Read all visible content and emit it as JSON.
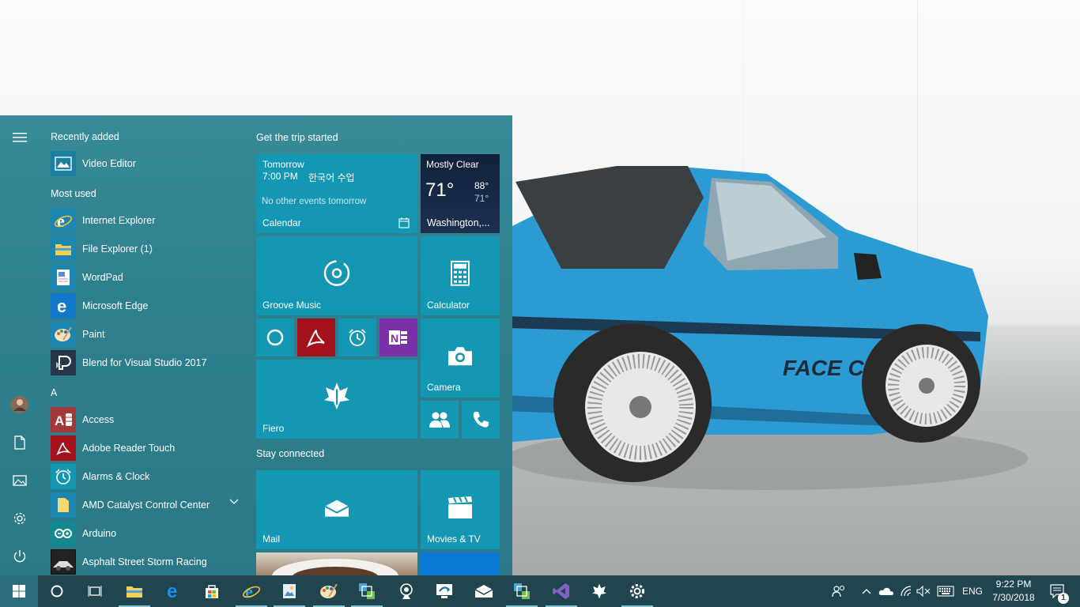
{
  "start_menu": {
    "sections": {
      "recently_added": "Recently added",
      "most_used": "Most used",
      "letter_a": "A"
    },
    "recently_added": [
      {
        "label": "Video Editor",
        "icon": "video-editor-icon"
      }
    ],
    "most_used": [
      {
        "label": "Internet Explorer",
        "icon": "internet-explorer-icon"
      },
      {
        "label": "File Explorer (1)",
        "icon": "file-explorer-icon"
      },
      {
        "label": "WordPad",
        "icon": "wordpad-icon"
      },
      {
        "label": "Microsoft Edge",
        "icon": "edge-icon"
      },
      {
        "label": "Paint",
        "icon": "paint-icon"
      },
      {
        "label": "Blend for Visual Studio 2017",
        "icon": "blend-icon"
      }
    ],
    "a_apps": [
      {
        "label": "Access",
        "icon": "access-icon"
      },
      {
        "label": "Adobe Reader Touch",
        "icon": "adobe-reader-icon"
      },
      {
        "label": "Alarms & Clock",
        "icon": "alarm-clock-icon"
      },
      {
        "label": "AMD Catalyst Control Center",
        "icon": "folder-icon",
        "expandable": true
      },
      {
        "label": "Arduino",
        "icon": "arduino-icon"
      },
      {
        "label": "Asphalt Street Storm Racing",
        "icon": "asphalt-icon"
      }
    ],
    "rail": [
      "hamburger-icon",
      "user-avatar",
      "documents-icon",
      "pictures-icon",
      "settings-icon",
      "power-icon"
    ]
  },
  "tiles": {
    "group1_title": "Get the trip started",
    "group2_title": "Stay connected",
    "calendar": {
      "day": "Tomorrow",
      "time": "7:00 PM",
      "event": "한국어 수업",
      "note": "No other events tomorrow",
      "label": "Calendar"
    },
    "weather": {
      "condition": "Mostly Clear",
      "temp": "71°",
      "high": "88°",
      "low": "71°",
      "location": "Washington,..."
    },
    "groove": {
      "label": "Groove Music"
    },
    "calculator": {
      "label": "Calculator"
    },
    "camera": {
      "label": "Camera"
    },
    "fiero": {
      "label": "Fiero"
    },
    "mail": {
      "label": "Mail"
    },
    "movies": {
      "label": "Movies & TV"
    },
    "small": [
      "cortana-icon",
      "adobe-acrobat-icon",
      "alarm-clock-icon",
      "onenote-icon",
      "people-icon",
      "phone-icon"
    ]
  },
  "taskbar": {
    "apps": [
      "cortana-icon",
      "task-view-icon",
      "file-explorer-icon",
      "edge-icon",
      "store-icon",
      "internet-explorer-icon",
      "photo-viewer-icon",
      "paint-icon",
      "network-app-icon",
      "webcam-icon",
      "remote-desktop-icon",
      "mail-icon",
      "network-app-2-icon",
      "visual-studio-icon",
      "fiero-icon",
      "settings-icon"
    ],
    "tray": {
      "language": "ENG",
      "time": "9:22 PM",
      "date": "7/30/2018",
      "notification_count": "1"
    }
  },
  "colors": {
    "menu_bg": "#2e7f8d",
    "tile_blue": "#1497b2",
    "adobe_red": "#a4111b",
    "onenote_purple": "#7b2fa8",
    "taskbar": "#20454e",
    "car_blue": "#2d9bd3"
  }
}
